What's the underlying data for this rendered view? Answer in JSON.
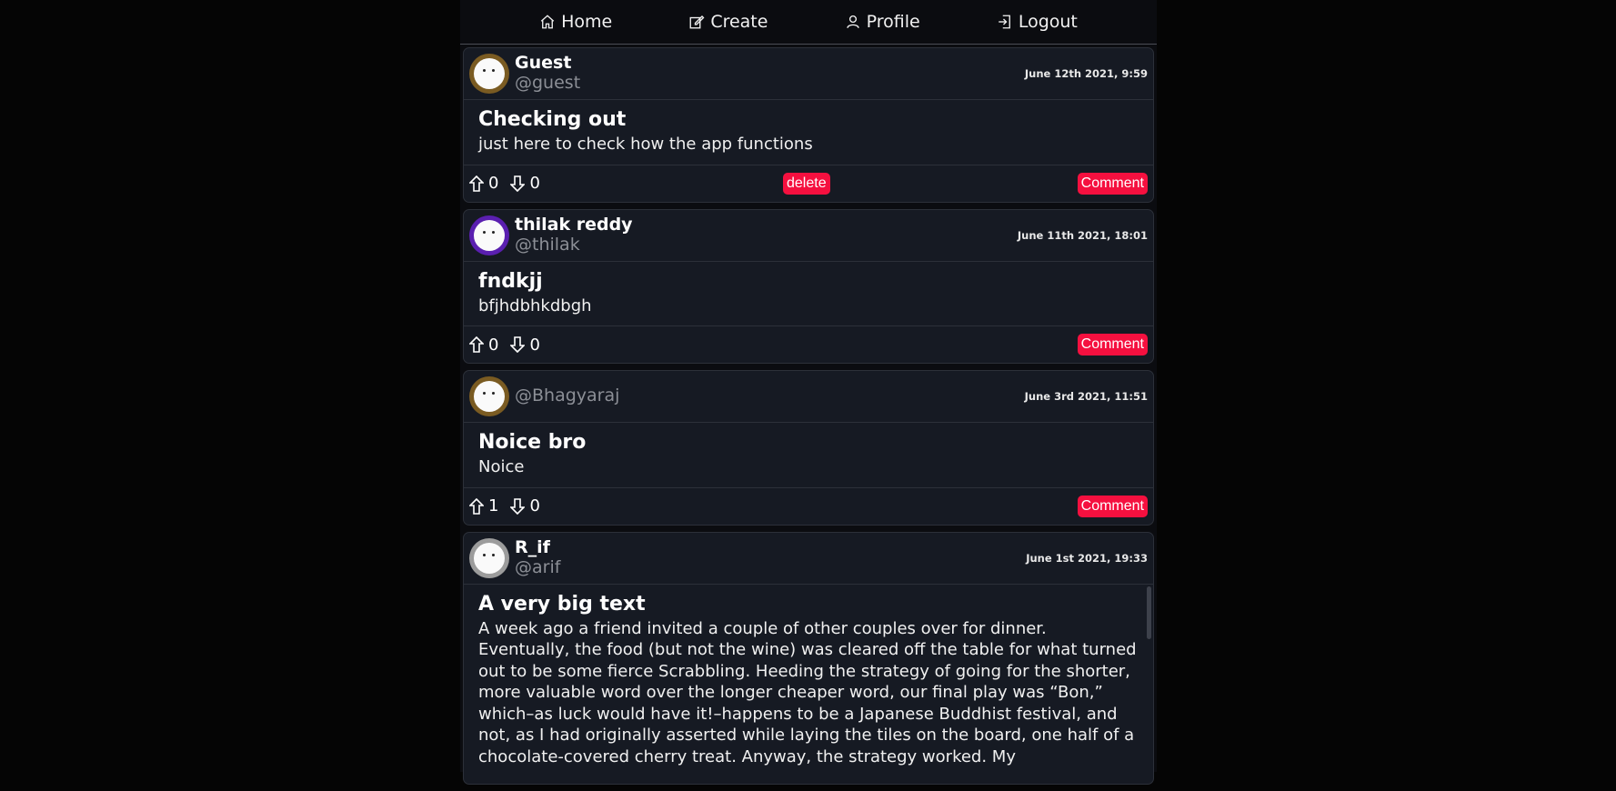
{
  "nav": {
    "home": "Home",
    "create": "Create",
    "profile": "Profile",
    "logout": "Logout"
  },
  "posts": [
    {
      "display_name": "Guest",
      "handle": "@guest",
      "date": "June 12th 2021, 9:59",
      "title": "Checking out",
      "text": "just here to check how the app functions",
      "upvotes": "0",
      "downvotes": "0",
      "delete_label": "delete",
      "comment_label": "Comment"
    },
    {
      "display_name": "thilak reddy",
      "handle": "@thilak",
      "date": "June 11th 2021, 18:01",
      "title": "fndkjj",
      "text": "bfjhdbhkdbgh",
      "upvotes": "0",
      "downvotes": "0",
      "comment_label": "Comment"
    },
    {
      "handle": "@Bhagyaraj",
      "date": "June 3rd 2021, 11:51",
      "title": "Noice bro",
      "text": "Noice",
      "upvotes": "1",
      "downvotes": "0",
      "comment_label": "Comment"
    },
    {
      "display_name": "R_if",
      "handle": "@arif",
      "date": "June 1st 2021, 19:33",
      "title": "A very big text",
      "text": "A week ago a friend invited a couple of other couples over for dinner. Eventually, the food (but not the wine) was cleared off the table for what turned out to be some fierce Scrabbling. Heeding the strategy of going for the shorter, more valuable word over the longer cheaper word, our final play was “Bon,” which–as luck would have it!–happens to be a Japanese Buddhist festival, and not, as I had originally asserted while laying the tiles on the board, one half of a chocolate-covered cherry treat. Anyway, the strategy worked. My"
    }
  ],
  "colors": {
    "accent": "#f5103f",
    "card_bg": "#161a23",
    "page_bg": "#050505"
  }
}
